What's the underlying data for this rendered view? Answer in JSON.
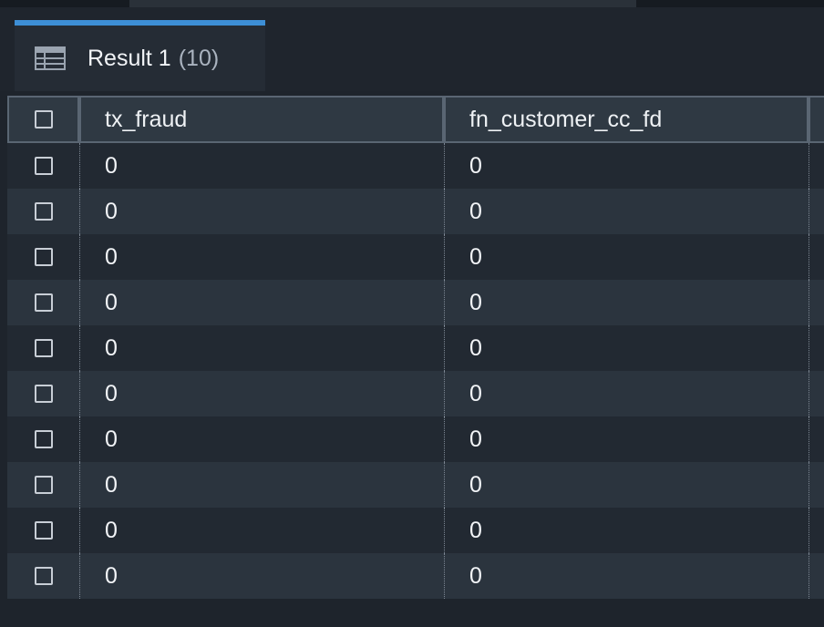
{
  "result_tab": {
    "label": "Result 1",
    "count": "(10)",
    "icon": "table-icon"
  },
  "columns": [
    "tx_fraud",
    "fn_customer_cc_fd"
  ],
  "rows": [
    [
      "0",
      "0"
    ],
    [
      "0",
      "0"
    ],
    [
      "0",
      "0"
    ],
    [
      "0",
      "0"
    ],
    [
      "0",
      "0"
    ],
    [
      "0",
      "0"
    ],
    [
      "0",
      "0"
    ],
    [
      "0",
      "0"
    ],
    [
      "0",
      "0"
    ],
    [
      "0",
      "0"
    ]
  ],
  "colors": {
    "accent": "#3d8fd6",
    "background": "#1e242c",
    "row_odd": "#222932",
    "row_even": "#2b343e",
    "header": "#2f3943"
  }
}
